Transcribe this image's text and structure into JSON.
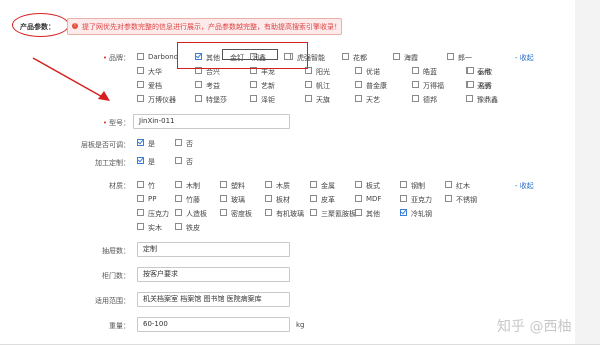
{
  "section_title": "产品参数：",
  "notice": "提了网优先对参数完整的信息进行展示，产品参数越完整，有助提高搜索引擎收录！",
  "brand": {
    "label": "品牌：",
    "collapse": "- 收起",
    "rows": [
      [
        {
          "t": "Darbond",
          "c": false
        },
        {
          "t": "其他",
          "c": true
        },
        {
          "t": "",
          "c": false
        },
        {
          "t": "",
          "c": false
        },
        {
          "t": "",
          "c": false
        },
        {
          "t": "海霞",
          "c": false
        },
        {
          "t": "郎一",
          "c": false
        }
      ],
      [
        {
          "t": "大华",
          "c": false
        },
        {
          "t": "合兴",
          "c": false
        },
        {
          "t": "丰龙",
          "c": false
        },
        {
          "t": "阳光",
          "c": false
        },
        {
          "t": "优诺",
          "c": false
        },
        {
          "t": "皓蓝",
          "c": false
        },
        {
          "t": "泰格",
          "c": false
        },
        {
          "t": "云欣",
          "c": false
        }
      ],
      [
        {
          "t": "爱档",
          "c": false
        },
        {
          "t": "考益",
          "c": false
        },
        {
          "t": "艺新",
          "c": false
        },
        {
          "t": "帆江",
          "c": false
        },
        {
          "t": "普金康",
          "c": false
        },
        {
          "t": "万得福",
          "c": false
        },
        {
          "t": "天丽",
          "c": false
        },
        {
          "t": "名秀",
          "c": false
        }
      ],
      [
        {
          "t": "万博仪器",
          "c": false
        },
        {
          "t": "特堡莎",
          "c": false
        },
        {
          "t": "泽钜",
          "c": false
        },
        {
          "t": "天旗",
          "c": false
        },
        {
          "t": "天艺",
          "c": false
        },
        {
          "t": "德邦",
          "c": false
        },
        {
          "t": "豫鼎鑫",
          "c": false
        }
      ]
    ],
    "row1_extra": {
      "smart": "虎强智能",
      "huahua": "花都",
      "hl1": "金钉",
      "hl2": "润鑫"
    }
  },
  "model": {
    "label": "型号：",
    "value": "JinXin-011"
  },
  "adjustable": {
    "label": "层板是否可调：",
    "yes": "是",
    "no": "否",
    "yes_checked": true,
    "no_checked": false
  },
  "customizable": {
    "label": "加工定制：",
    "yes": "是",
    "no": "否",
    "yes_checked": true,
    "no_checked": false
  },
  "material": {
    "label": "材质：",
    "collapse": "- 收起",
    "rows": [
      [
        {
          "t": "竹",
          "c": false
        },
        {
          "t": "木制",
          "c": false
        },
        {
          "t": "塑料",
          "c": false
        },
        {
          "t": "木质",
          "c": false
        },
        {
          "t": "金属",
          "c": false
        },
        {
          "t": "板式",
          "c": false
        },
        {
          "t": "钢制",
          "c": false
        },
        {
          "t": "红木",
          "c": false
        }
      ],
      [
        {
          "t": "PP",
          "c": false
        },
        {
          "t": "竹藤",
          "c": false
        },
        {
          "t": "玻璃",
          "c": false
        },
        {
          "t": "板材",
          "c": false
        },
        {
          "t": "皮革",
          "c": false
        },
        {
          "t": "MDF",
          "c": false
        },
        {
          "t": "亚克力",
          "c": false
        },
        {
          "t": "不锈钢",
          "c": false
        }
      ],
      [
        {
          "t": "压克力",
          "c": false
        },
        {
          "t": "人造板",
          "c": false
        },
        {
          "t": "密度板",
          "c": false
        },
        {
          "t": "有机玻璃",
          "c": false
        },
        {
          "t": "三聚氰胺板",
          "c": false
        },
        {
          "t": "其他",
          "c": false
        },
        {
          "t": "冷轧钢",
          "c": true
        }
      ],
      [
        {
          "t": "实木",
          "c": false
        },
        {
          "t": "铁皮",
          "c": false
        }
      ]
    ]
  },
  "drawers": {
    "label": "抽屉数：",
    "value": "定制"
  },
  "doors": {
    "label": "柜门数：",
    "value": "按客户要求"
  },
  "usage": {
    "label": "适用范围：",
    "value": "机关档案室 档案馆 图书馆 医院病案库"
  },
  "weight": {
    "label": "重量：",
    "value": "60-100",
    "unit": "kg"
  },
  "watermark": "知乎 @西柚",
  "colors": {
    "accent": "#2a6ec6",
    "annotation": "#d62020",
    "notice_bg": "#fdeaea",
    "check": "#3b7fd8"
  }
}
